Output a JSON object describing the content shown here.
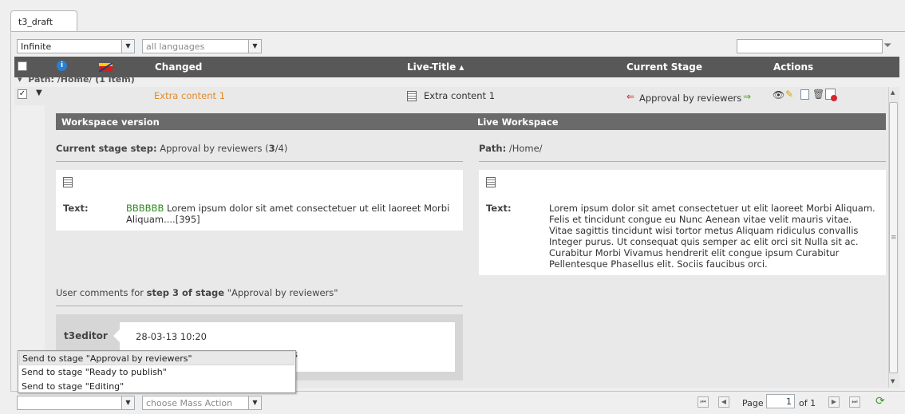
{
  "tab": {
    "label": "t3_draft"
  },
  "filters": {
    "depth": "Infinite",
    "language": "all languages"
  },
  "columns": {
    "changed": "Changed",
    "live_title": "Live-Title ▴",
    "current_stage": "Current Stage",
    "actions": "Actions"
  },
  "group": {
    "label": "Path: /Home/ (1 item)"
  },
  "record": {
    "changed": "Extra content 1",
    "live_title": "Extra content 1",
    "stage": "Approval by reviewers"
  },
  "detail": {
    "workspace_header": "Workspace version",
    "live_header": "Live Workspace",
    "stage_step_label": "Current stage step:",
    "stage_step_value": "Approval by reviewers (",
    "stage_step_num": "3",
    "stage_step_tail": "/4)",
    "path_label": "Path:",
    "path_value": "/Home/",
    "text_label": "Text:",
    "ws_text_highlight": "BBBBBB",
    "ws_text": "Lorem ipsum dolor sit amet consectetuer ut elit laoreet Morbi Aliquam....[395]",
    "live_text": "Lorem ipsum dolor sit amet consectetuer ut elit laoreet Morbi Aliquam. Felis et tincidunt congue eu Nunc Aenean vitae velit mauris vitae. Vitae sagittis tincidunt wisi tortor metus Aliquam ridiculus convallis Integer purus. Ut consequat quis semper ac elit orci sit Nulla sit ac. Curabitur Morbi Vivamus hendrerit elit congue ipsum Curabitur Pellentesque Phasellus elit. Sociis faucibus orci.",
    "comments_prefix": "User comments for",
    "comments_step": "step 3 of stage",
    "comments_stage": "\"Approval by reviewers\"",
    "comment_user": "t3editor",
    "comment_date": "28-03-13 10:20",
    "comment_partial": "s"
  },
  "stage_menu": [
    "Send to stage \"Approval by reviewers\"",
    "Send to stage \"Ready to publish\"",
    "Send to stage \"Editing\""
  ],
  "footer": {
    "mass_action_placeholder": "choose Mass Action",
    "page_label": "Page",
    "page_value": "1",
    "page_of": "of 1"
  },
  "colors": {
    "header_bg": "#585858",
    "orange_link": "#e38a2b",
    "green_text": "#2e8b1e",
    "stage_prev_arrow": "#d9262b",
    "stage_next_arrow": "#4aa31e"
  }
}
